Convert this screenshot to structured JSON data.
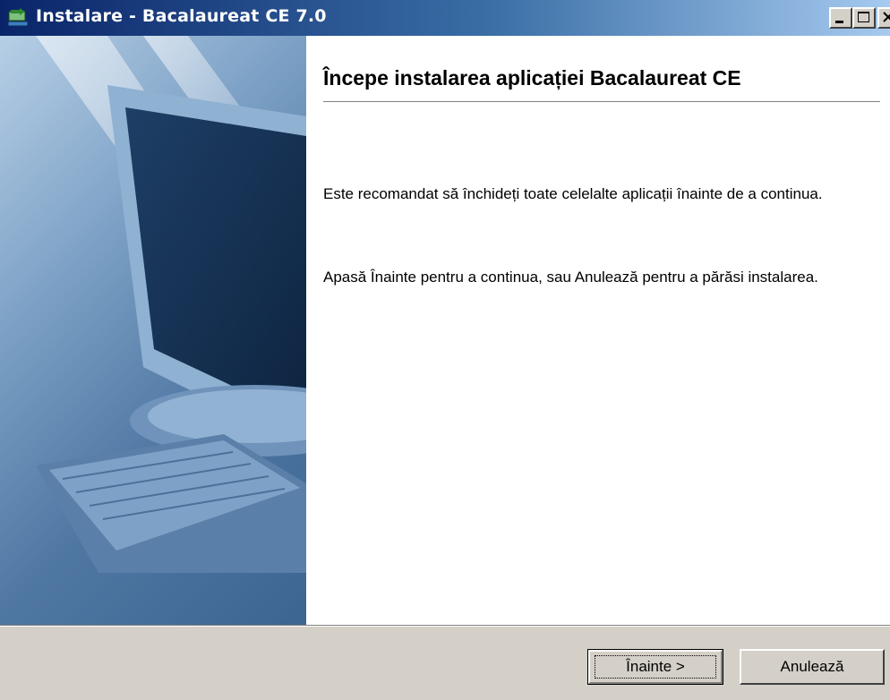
{
  "window": {
    "title": "Instalare - Bacalaureat CE 7.0",
    "icons": {
      "app": "installer-icon",
      "minimize": "minimize-icon",
      "maximize": "maximize-icon",
      "close": "close-icon"
    }
  },
  "main": {
    "heading": "Începe instalarea aplicației Bacalaureat CE",
    "paragraph1": "Este recomandat să închideți toate celelalte aplicații înainte de a continua.",
    "paragraph2": "Apasă Înainte pentru a continua, sau Anulează pentru a părăsi instalarea."
  },
  "buttons": {
    "next": "Înainte >",
    "cancel": "Anulează"
  },
  "colors": {
    "titlebar_start": "#0a246a",
    "titlebar_end": "#a6caf0",
    "dialog_face": "#d4d0c8"
  }
}
